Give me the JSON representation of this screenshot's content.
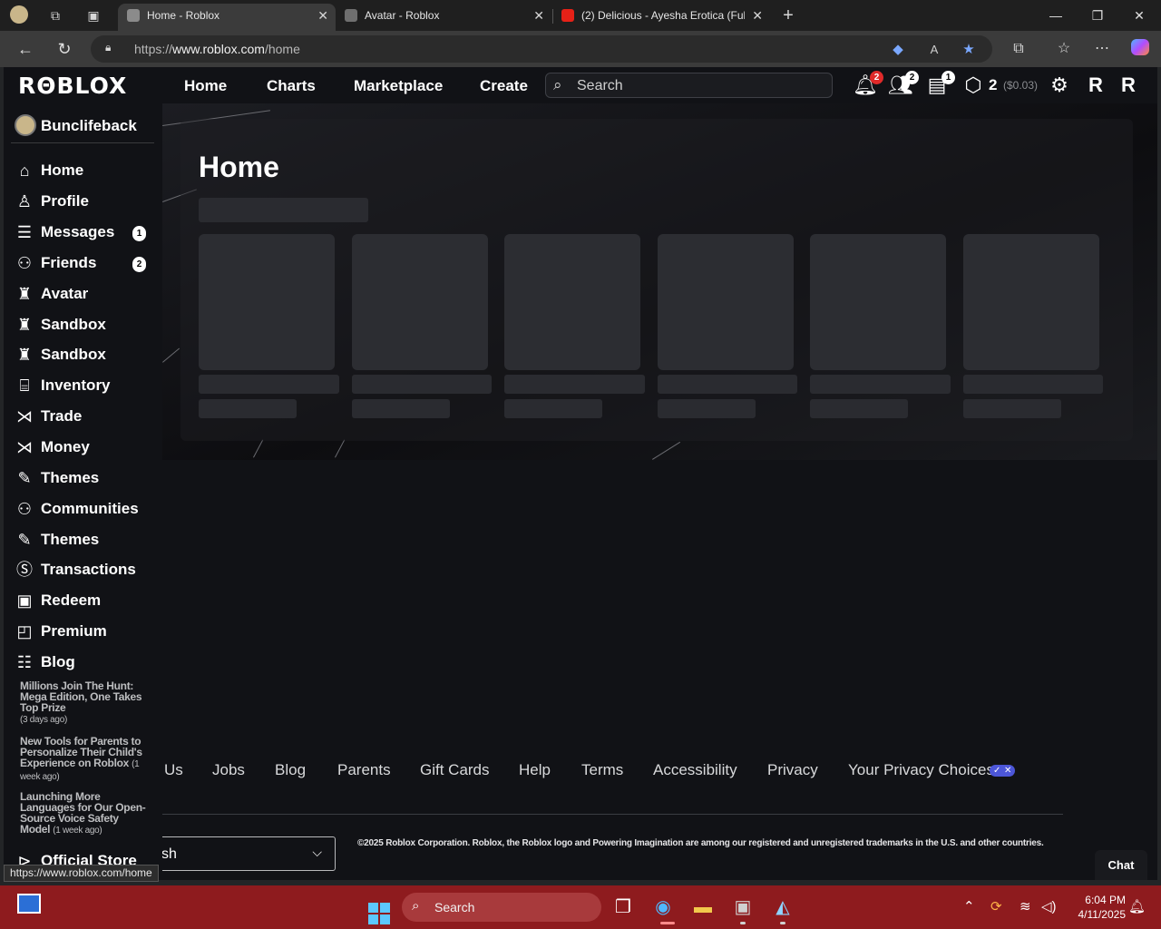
{
  "browser": {
    "tabs": [
      {
        "title": "Home - Roblox",
        "active": true
      },
      {
        "title": "Avatar - Roblox",
        "active": false
      },
      {
        "title": "(2) Delicious - Ayesha Erotica (Full",
        "active": false
      }
    ],
    "new_tab_icon": "plus-icon",
    "address": {
      "prefix": "https://",
      "host": "www.roblox.com",
      "path": "/home"
    },
    "status_url": "https://www.roblox.com/home"
  },
  "header": {
    "logo": "RΘBLOX",
    "nav": [
      "Home",
      "Charts",
      "Marketplace",
      "Create"
    ],
    "search_placeholder": "Search",
    "notifications_count": "2",
    "friends_requests_count": "2",
    "messages_count": "1",
    "robux": "2",
    "robux_usd": "($0.03)"
  },
  "sidebar": {
    "username": "Bunclifeback",
    "items": [
      {
        "label": "Home",
        "icon": "home-icon"
      },
      {
        "label": "Profile",
        "icon": "profile-icon"
      },
      {
        "label": "Messages",
        "icon": "messages-icon",
        "count": "1"
      },
      {
        "label": "Friends",
        "icon": "friends-icon",
        "count": "2"
      },
      {
        "label": "Avatar",
        "icon": "avatar-icon"
      },
      {
        "label": "Sandbox",
        "icon": "sandbox-icon"
      },
      {
        "label": "Sandbox",
        "icon": "sandbox-icon"
      },
      {
        "label": "Inventory",
        "icon": "inventory-icon"
      },
      {
        "label": "Trade",
        "icon": "trade-icon"
      },
      {
        "label": "Money",
        "icon": "money-icon"
      },
      {
        "label": "Themes",
        "icon": "themes-icon"
      },
      {
        "label": "Communities",
        "icon": "communities-icon"
      },
      {
        "label": "Themes",
        "icon": "themes-icon"
      },
      {
        "label": "Transactions",
        "icon": "transactions-icon"
      },
      {
        "label": "Redeem",
        "icon": "redeem-icon"
      },
      {
        "label": "Premium",
        "icon": "premium-icon"
      },
      {
        "label": "Blog",
        "icon": "blog-icon"
      }
    ],
    "blog_posts": [
      {
        "title": "Millions Join The Hunt: Mega Edition, One Takes Top Prize",
        "ago": "(3 days ago)"
      },
      {
        "title": "New Tools for Parents to Personalize Their Child's Experience on Roblox",
        "ago": "(1 week ago)"
      },
      {
        "title": "Launching More Languages for Our Open-Source Voice Safety Model",
        "ago": "(1 week ago)"
      }
    ],
    "official_store": "Official Store"
  },
  "main": {
    "title": "Home",
    "footer_links": [
      "Us",
      "Jobs",
      "Blog",
      "Parents",
      "Gift Cards",
      "Help",
      "Terms",
      "Accessibility",
      "Privacy",
      "Your Privacy Choices"
    ],
    "language_value": "sh",
    "copyright": "©2025 Roblox Corporation. Roblox, the Roblox logo and Powering Imagination are among our registered and unregistered trademarks in the U.S. and other countries.",
    "chat_label": "Chat"
  },
  "taskbar": {
    "search_placeholder": "Search",
    "time": "6:04 PM",
    "date": "4/11/2025"
  },
  "colors": {
    "taskbar": "#8e1b1e",
    "roblox_bg": "#111216",
    "badge_red": "#e02a2a"
  }
}
